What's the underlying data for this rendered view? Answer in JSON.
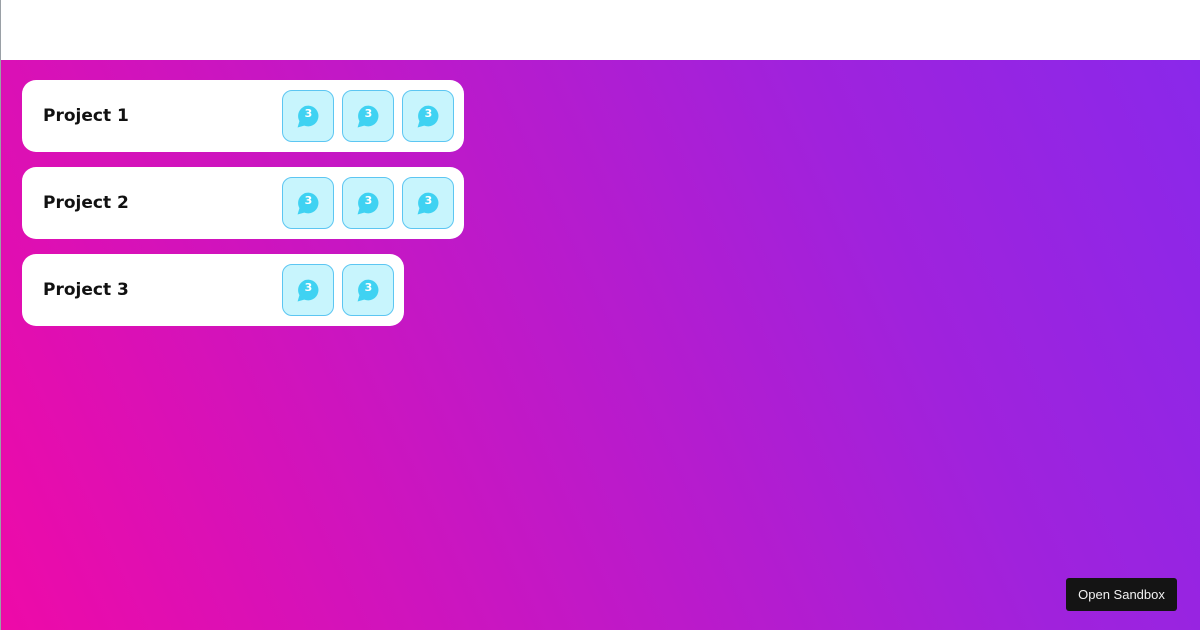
{
  "colors": {
    "gradient_start": "#ee0aa8",
    "gradient_end": "#8a28ea",
    "tile_fill": "#c8f5fd",
    "tile_border": "#5cc6f2",
    "icon_color": "#3fd2f2",
    "button_bg": "#141414"
  },
  "projects": [
    {
      "title": "Project 1",
      "items": [
        {
          "icon": "chat-bubble-icon",
          "count": "3"
        },
        {
          "icon": "chat-bubble-icon",
          "count": "3"
        },
        {
          "icon": "chat-bubble-icon",
          "count": "3"
        }
      ]
    },
    {
      "title": "Project 2",
      "items": [
        {
          "icon": "chat-bubble-icon",
          "count": "3"
        },
        {
          "icon": "chat-bubble-icon",
          "count": "3"
        },
        {
          "icon": "chat-bubble-icon",
          "count": "3"
        }
      ]
    },
    {
      "title": "Project 3",
      "items": [
        {
          "icon": "chat-bubble-icon",
          "count": "3"
        },
        {
          "icon": "chat-bubble-icon",
          "count": "3"
        }
      ]
    }
  ],
  "sandbox_button": {
    "label": "Open Sandbox"
  }
}
